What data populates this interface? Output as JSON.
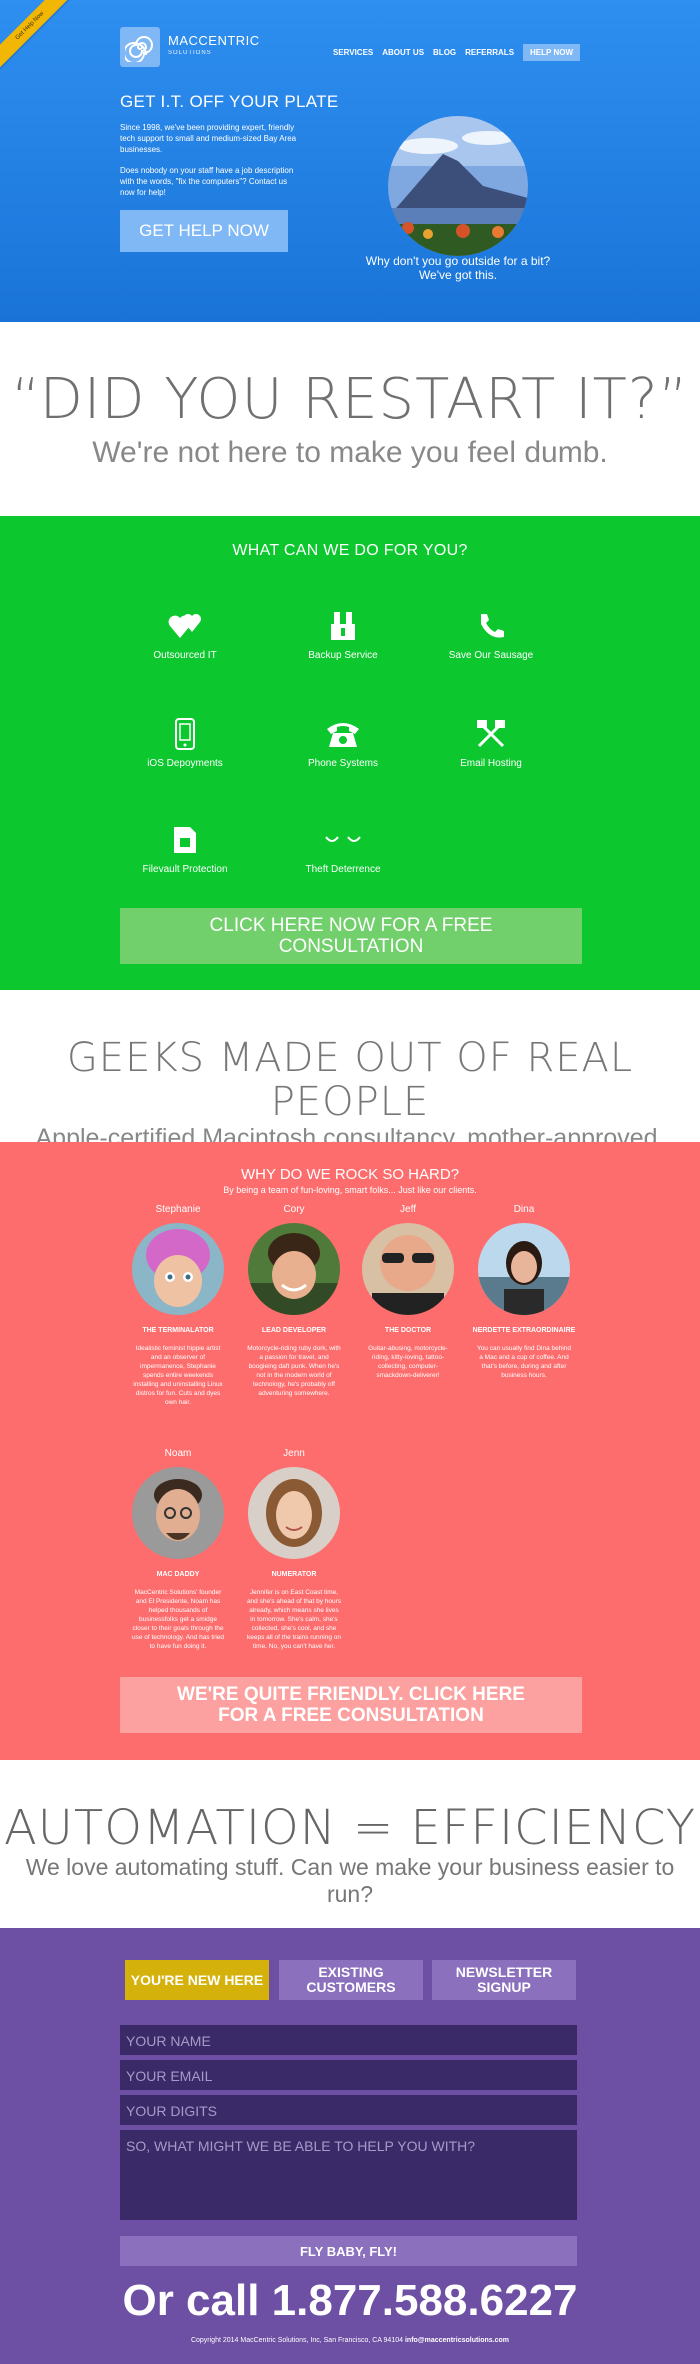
{
  "hero": {
    "ribbon": "Get Help Now",
    "logo_title": "MACCENTRIC",
    "logo_sub": "SOLUTIONS",
    "nav": [
      "SERVICES",
      "ABOUT US",
      "BLOG",
      "REFERRALS"
    ],
    "nav_help": "HELP NOW",
    "title": "GET I.T. OFF YOUR PLATE",
    "p1": "Since 1998, we've been providing expert, friendly tech support to small and medium-sized Bay Area businesses.",
    "p2": "Does nobody on your staff have a job description with the words, \"fix the computers\"? Contact us now for help!",
    "cta": "GET HELP NOW",
    "caption": "Why don't you go outside for a bit? We've got this.",
    "colors": {
      "bg": "#1f7fe3",
      "button": "#7fb8f5"
    }
  },
  "restart": {
    "title": "“DID YOU RESTART IT?”",
    "sub": "We're not here to make you feel dumb."
  },
  "services": {
    "title": "WHAT CAN WE DO FOR YOU?",
    "items": [
      {
        "label": "Outsourced IT",
        "icon": "hearts-icon"
      },
      {
        "label": "Backup Service",
        "icon": "backup-icon"
      },
      {
        "label": "Save Our Sausage",
        "icon": "sausage-icon"
      },
      {
        "label": "iOS Depoyments",
        "icon": "phone-device-icon"
      },
      {
        "label": "Phone Systems",
        "icon": "telephone-icon"
      },
      {
        "label": "Email Hosting",
        "icon": "email-hosting-icon"
      },
      {
        "label": "Filevault Protection",
        "icon": "filevault-icon"
      },
      {
        "label": "Theft Deterrence",
        "icon": "eyes-icon"
      }
    ],
    "cta": "CLICK HERE NOW FOR A FREE CONSULTATION",
    "colors": {
      "bg": "#0cc72e",
      "button": "#72d06c"
    }
  },
  "geeks": {
    "title": "GEEKS MADE OUT OF REAL PEOPLE",
    "sub": "Apple-certified Macintosh consultancy, mother-approved."
  },
  "team": {
    "title": "WHY DO WE ROCK SO HARD?",
    "sub": "By being a team of fun-loving, smart folks... Just like our clients.",
    "members": [
      {
        "name": "Stephanie",
        "role": "THE TERMINALATOR",
        "bio": "Idealistic feminist hippie artist and an observer of impermanence, Stephanie spends entire weekends installing and uninstalling Linux distros for fun. Cuts and dyes own hair."
      },
      {
        "name": "Cory",
        "role": "LEAD DEVELOPER",
        "bio": "Motorcycle-riding ruby dork, with a passion for travel, and boogieing daft punk. When he's not in the modern world of technology, he's probably off adventuring somewhere."
      },
      {
        "name": "Jeff",
        "role": "THE DOCTOR",
        "bio": "Guitar-abusing, motorcycle-riding, kitty-loving, tattoo-collecting, computer-smackdown-deliverer!"
      },
      {
        "name": "Dina",
        "role": "NERDETTE EXTRAORDINAIRE",
        "bio": "You can usually find Dina behind a Mac and a cup of coffee. And that's before, during and after business hours."
      },
      {
        "name": "Noam",
        "role": "MAC DADDY",
        "bio": "MacCentric Solutions' founder and El Presidente, Noam has helped thousands of businessfolks get a smidge closer to their goals through the use of technology. And has tried to have fun doing it."
      },
      {
        "name": "Jenn",
        "role": "NUMERATOR",
        "bio": "Jennifer is on East Coast time, and she's ahead of that by hours already, which means she lives in tomorrow. She's calm, she's collected, she's cool, and she keeps all of the trains running on time. No, you can't have her."
      }
    ],
    "cta": "WE'RE QUITE FRIENDLY. CLICK HERE FOR A FREE CONSULTATION",
    "colors": {
      "bg": "#fd6d6d",
      "button": "#fca0a0"
    }
  },
  "automation": {
    "title": "AUTOMATION = EFFICIENCY",
    "sub": "We love automating stuff. Can we make your business easier to run?"
  },
  "contact": {
    "tabs": [
      "YOU'RE NEW HERE",
      "EXISTING CUSTOMERS",
      "NEWSLETTER SIGNUP"
    ],
    "active_tab": "YOU'RE NEW HERE",
    "name_placeholder": "YOUR NAME",
    "email_placeholder": "YOUR EMAIL",
    "digits_placeholder": "YOUR DIGITS",
    "message_placeholder": "SO, WHAT MIGHT WE BE ABLE TO HELP YOU WITH?",
    "submit": "FLY BABY, FLY!",
    "phone": "Or call 1.877.588.6227",
    "copyright": "Copyright 2014 MacCentric Solutions, Inc, San Francisco, CA 94104",
    "email": "info@maccentricsolutions.com",
    "colors": {
      "bg": "#6d4fa3",
      "field": "#3a2a68",
      "tab": "#8a70bd",
      "tab_active": "#d4b20b"
    }
  }
}
